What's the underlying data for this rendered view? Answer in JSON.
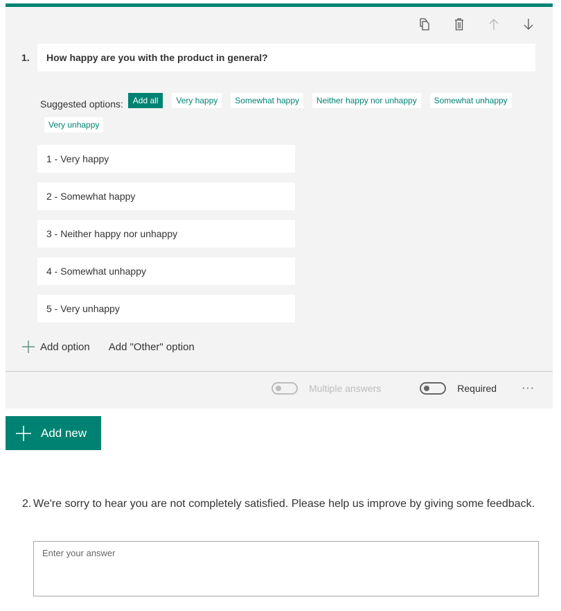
{
  "colors": {
    "accent": "#008272",
    "card_bg": "#f3f3f3"
  },
  "toolbar": {
    "icons": [
      "copy-icon",
      "delete-icon",
      "move-up-icon",
      "move-down-icon"
    ]
  },
  "question1": {
    "number": "1.",
    "title": "How happy are you with the product in general?",
    "suggested_label": "Suggested options:",
    "add_all_label": "Add all",
    "suggestions": [
      "Very happy",
      "Somewhat happy",
      "Neither happy nor unhappy",
      "Somewhat unhappy",
      "Very unhappy"
    ],
    "options": [
      "1 - Very happy",
      "2 - Somewhat happy",
      "3 - Neither happy nor unhappy",
      "4 - Somewhat unhappy",
      "5 - Very unhappy"
    ],
    "add_option_label": "Add option",
    "add_other_label": "Add \"Other\" option",
    "multiple_answers_label": "Multiple answers",
    "multiple_answers_on": false,
    "required_label": "Required",
    "required_on": false,
    "more_label": "···"
  },
  "add_new_label": "Add new",
  "question2": {
    "number": "2.",
    "title": "We're sorry to hear you are not completely satisfied. Please help us improve by giving some feedback.",
    "placeholder": "Enter your answer"
  }
}
